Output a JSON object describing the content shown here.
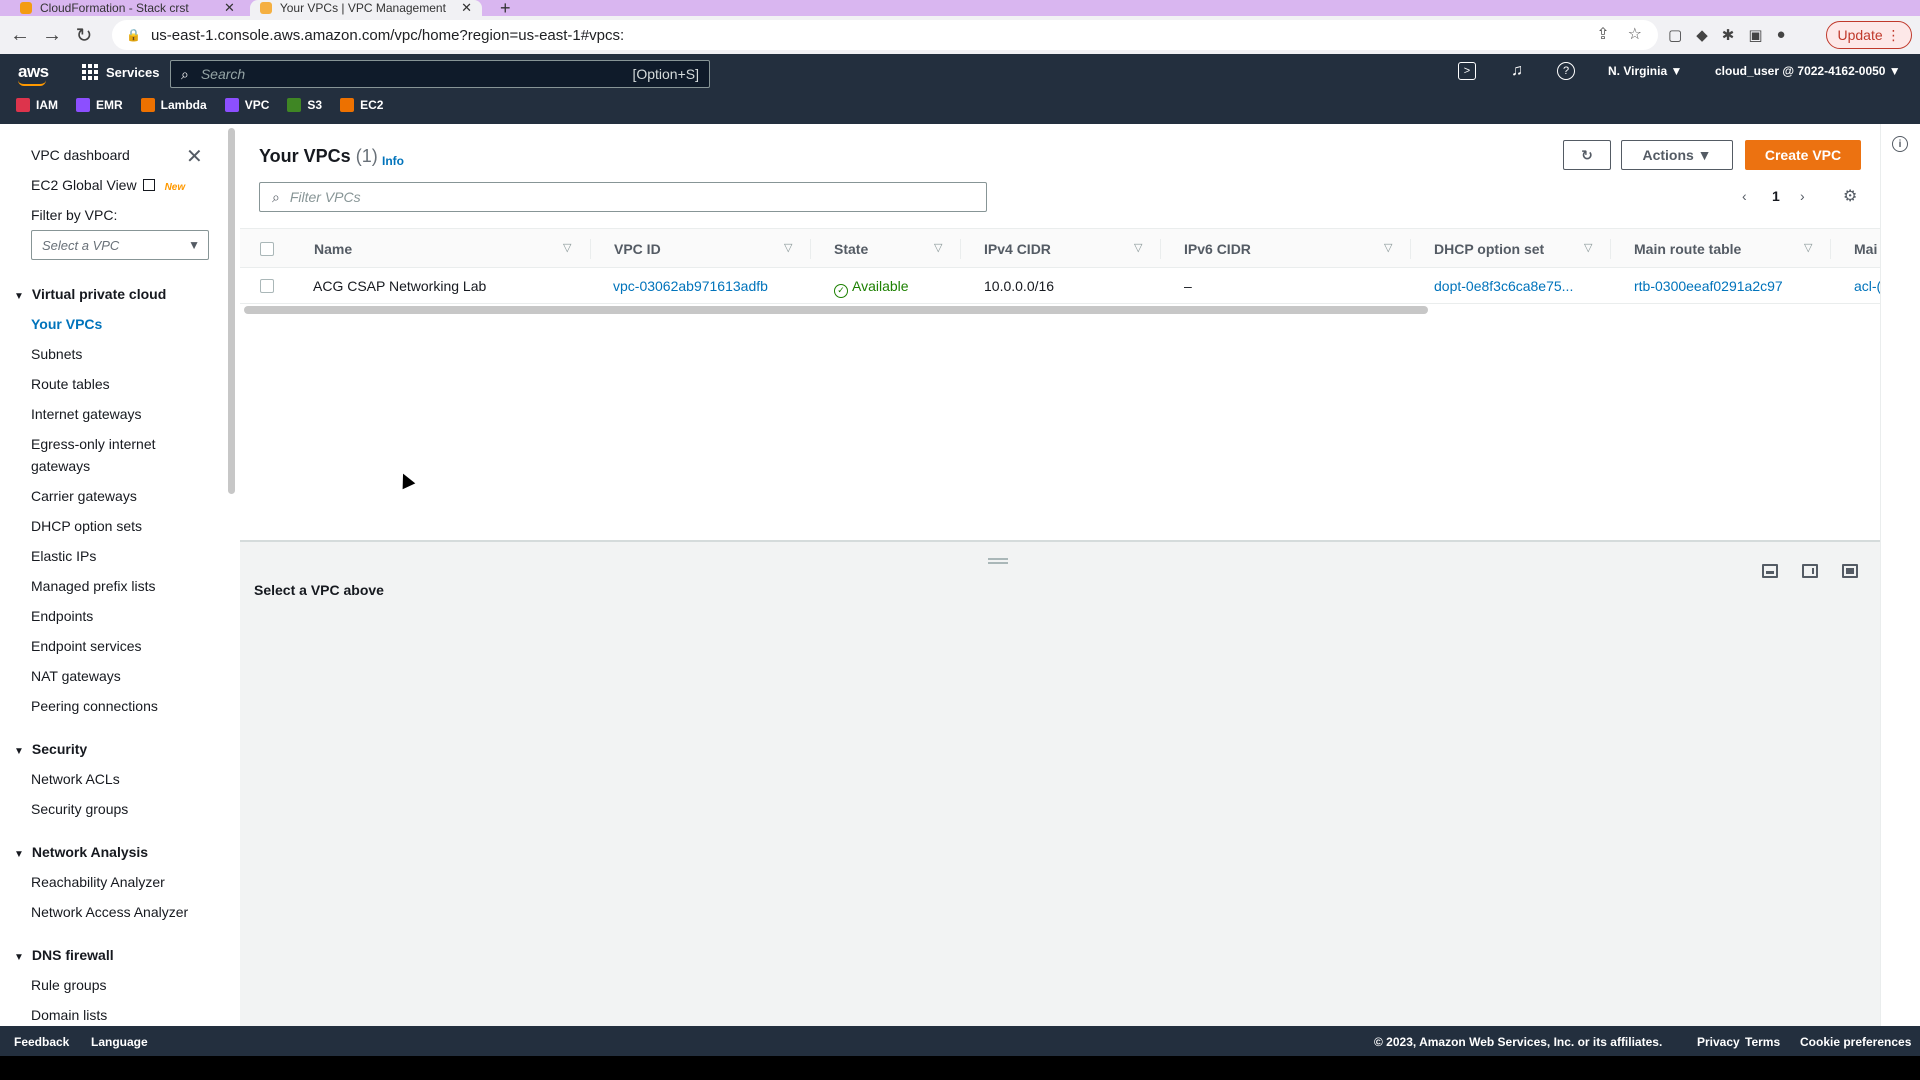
{
  "browser": {
    "tabs": [
      {
        "label": "CloudFormation - Stack crst",
        "active": false
      },
      {
        "label": "Your VPCs | VPC Management",
        "active": true
      }
    ],
    "new_tab": "+",
    "url": "us-east-1.console.aws.amazon.com/vpc/home?region=us-east-1#vpcs:",
    "update_label": "Update"
  },
  "aws_nav": {
    "logo": "aws",
    "services_label": "Services",
    "search_placeholder": "Search",
    "search_shortcut": "[Option+S]",
    "region": "N. Virginia ▼",
    "account": "cloud_user @ 7022-4162-0050 ▼",
    "favorites": [
      {
        "label": "IAM",
        "color": "#dd344c"
      },
      {
        "label": "EMR",
        "color": "#8c4fff"
      },
      {
        "label": "Lambda",
        "color": "#ed7100"
      },
      {
        "label": "VPC",
        "color": "#8c4fff"
      },
      {
        "label": "S3",
        "color": "#3f8624"
      },
      {
        "label": "EC2",
        "color": "#ed7100"
      }
    ]
  },
  "sidebar": {
    "dashboard": "VPC dashboard",
    "global_view": "EC2 Global View",
    "new_badge": "New",
    "filter_label": "Filter by VPC:",
    "filter_placeholder": "Select a VPC",
    "sections": {
      "vpc": {
        "title": "Virtual private cloud",
        "items": [
          "Your VPCs",
          "Subnets",
          "Route tables",
          "Internet gateways",
          "Egress-only internet",
          "gateways",
          "Carrier gateways",
          "DHCP option sets",
          "Elastic IPs",
          "Managed prefix lists",
          "Endpoints",
          "Endpoint services",
          "NAT gateways",
          "Peering connections"
        ]
      },
      "security": {
        "title": "Security",
        "items": [
          "Network ACLs",
          "Security groups"
        ]
      },
      "network_analysis": {
        "title": "Network Analysis",
        "items": [
          "Reachability Analyzer",
          "Network Access Analyzer"
        ]
      },
      "dns_firewall": {
        "title": "DNS firewall",
        "items": [
          "Rule groups",
          "Domain lists"
        ]
      }
    }
  },
  "panel": {
    "title": "Your VPCs",
    "count": "(1)",
    "info": "Info",
    "actions_label": "Actions ▼",
    "create_label": "Create VPC",
    "filter_placeholder": "Filter VPCs",
    "page_number": "1",
    "columns": [
      "Name",
      "VPC ID",
      "State",
      "IPv4 CIDR",
      "IPv6 CIDR",
      "DHCP option set",
      "Main route table",
      "Mai"
    ],
    "row": {
      "name": "ACG CSAP Networking Lab",
      "vpc_id": "vpc-03062ab971613adfb",
      "state": "Available",
      "ipv4": "10.0.0.0/16",
      "ipv6": "–",
      "dhcp": "dopt-0e8f3c6ca8e75...",
      "route_table": "rtb-0300eeaf0291a2c97",
      "main_acl": "acl-("
    },
    "detail_message": "Select a VPC above"
  },
  "footer": {
    "feedback": "Feedback",
    "language": "Language",
    "copyright": "© 2023, Amazon Web Services, Inc. or its affiliates.",
    "privacy": "Privacy",
    "terms": "Terms",
    "cookies": "Cookie preferences"
  }
}
